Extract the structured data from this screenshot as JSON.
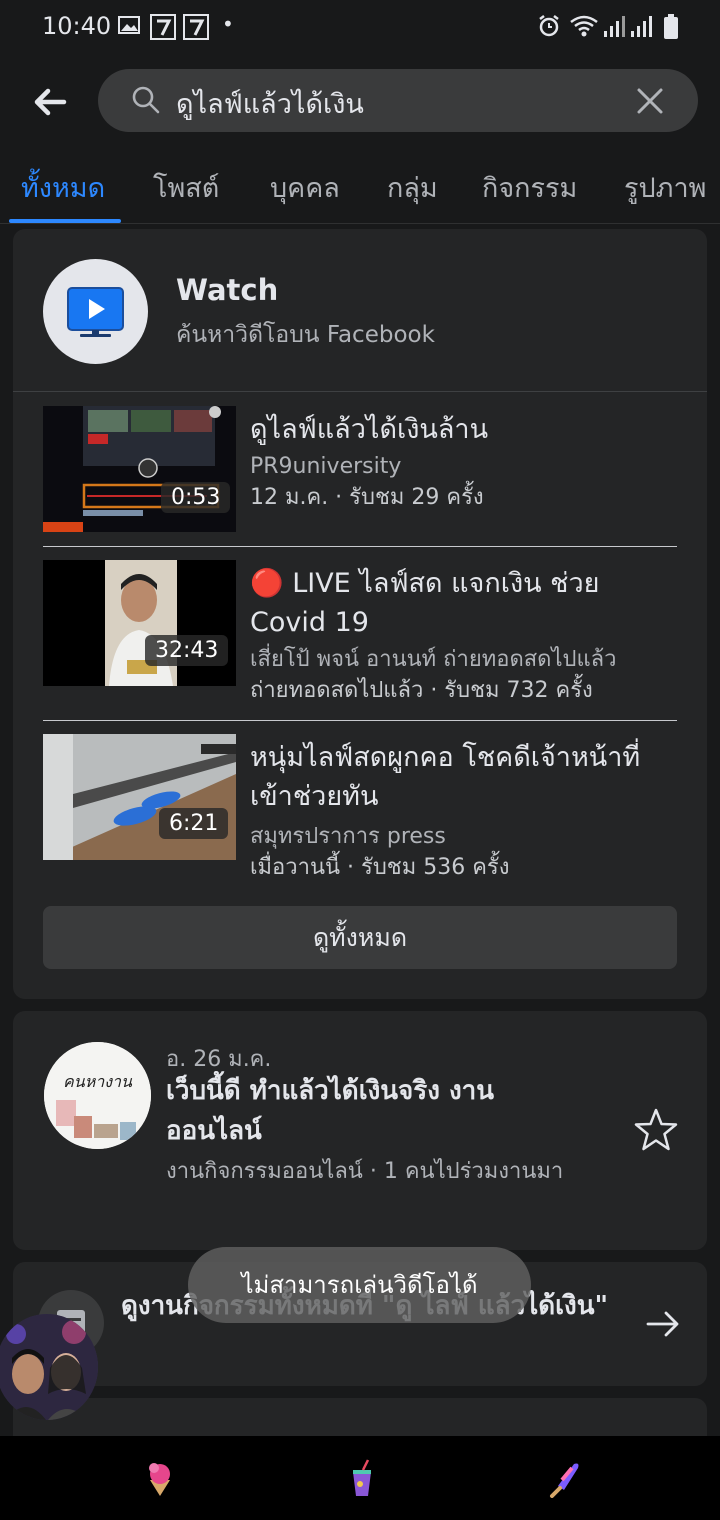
{
  "status_bar": {
    "time": "10:40",
    "dot": "•"
  },
  "search": {
    "query": "ดูไลฟ์แล้วได้เงิน",
    "back_icon": "back-arrow-icon",
    "clear_icon": "close-icon"
  },
  "tabs": [
    {
      "label": "ทั้งหมด",
      "active": true
    },
    {
      "label": "โพสต์"
    },
    {
      "label": "บุคคล"
    },
    {
      "label": "กลุ่ม"
    },
    {
      "label": "กิจกรรม"
    },
    {
      "label": "รูปภาพ"
    }
  ],
  "watch": {
    "title": "Watch",
    "subtitle": "ค้นหาวิดีโอบน Facebook",
    "videos": [
      {
        "title": "ดูไลฟ์แล้วได้เงินล้าน",
        "channel": "PR9university",
        "meta": "12 ม.ค. · รับชม 29 ครั้ง",
        "duration": "0:53"
      },
      {
        "title": "🔴 LIVE ไลฟ์สด แจกเงิน ช่วย Covid 19",
        "channel": "เสี่ยโป้ พจน์ อานนท์ ถ่ายทอดสดไปแล้ว",
        "meta": "ถ่ายทอดสดไปแล้ว · รับชม 732 ครั้ง",
        "duration": "32:43"
      },
      {
        "title": "หนุ่มไลฟ์สดผูกคอ โชคดีเจ้าหน้าที่เข้าช่วยทัน",
        "channel": "สมุทรปราการ press",
        "meta": "เมื่อวานนี้ · รับชม 536 ครั้ง",
        "duration": "6:21"
      }
    ],
    "see_all_label": "ดูทั้งหมด"
  },
  "event": {
    "date": "อ. 26 ม.ค.",
    "title": "เว็บนี้ดี ทำแล้วได้เงินจริง งานออนไลน์",
    "meta": "งานกิจกรรมออนไลน์ · 1 คนไปร่วมงานมา",
    "avatar_text": "คนหางาน"
  },
  "events_link": {
    "text": "ดูงานกิจกรรมทั้งหมดที่ \"ดู ไลฟ์ แล้วได้เงิน\""
  },
  "toast": {
    "text": "ไม่สามารถเล่นวิดีโอได้"
  },
  "colors": {
    "accent": "#2d88ff",
    "background": "#18191a",
    "card": "#242526",
    "secondary_text": "#b0b3b8"
  }
}
